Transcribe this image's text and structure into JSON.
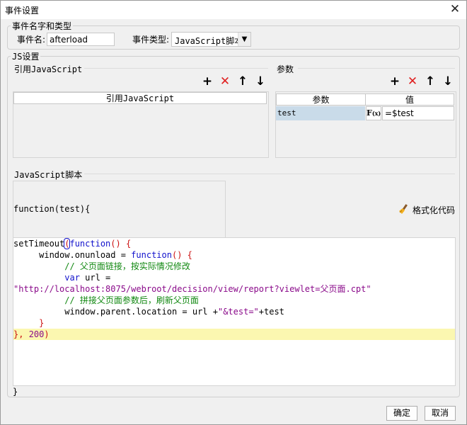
{
  "window": {
    "title": "事件设置",
    "close_glyph": "✕"
  },
  "event_group": {
    "legend": "事件名字和类型",
    "name_label": "事件名:",
    "name_value": "afterload",
    "type_label": "事件类型:",
    "type_value": "JavaScript脚本"
  },
  "js_group": {
    "legend": "JS设置",
    "ref_section": {
      "title": "引用JavaScript",
      "column_header": "引用JavaScript"
    },
    "params_section": {
      "title": "参数",
      "columns": [
        "参数",
        "值"
      ],
      "rows": [
        {
          "name": "test",
          "formula_icon": "Fx",
          "value": "=$test"
        }
      ]
    },
    "script_section": {
      "title": "JavaScript脚本",
      "signature": "function(test){",
      "format_button": "格式化代码"
    }
  },
  "code": {
    "l1": {
      "a": "setTimeout",
      "b": "(",
      "c": "function",
      "d": "() {"
    },
    "l2": {
      "a": "     window.onunload = ",
      "b": "function",
      "c": "() {"
    },
    "l3": "          // 父页面链接，按实际情况修改",
    "l4": {
      "a": "          ",
      "b": "var",
      "c": " url ="
    },
    "l5": "\"http://localhost:8075/webroot/decision/view/report?viewlet=父页面.cpt\"",
    "l6": "          // 拼接父页面参数后，刷新父页面",
    "l7": {
      "a": "          window.parent.location = url +",
      "b": "\"&test=\"",
      "c": "+test"
    },
    "l8": "     }",
    "l9": {
      "a": "}, ",
      "b": "200",
      "c": ")"
    },
    "closing": "}"
  },
  "footer": {
    "ok": "确定",
    "cancel": "取消"
  },
  "icons": {
    "add": "+",
    "remove": "✕",
    "up": "🡑",
    "down": "🡓",
    "add_color": "#111111",
    "remove_color": "#e02020",
    "accent": "#1111cc"
  }
}
